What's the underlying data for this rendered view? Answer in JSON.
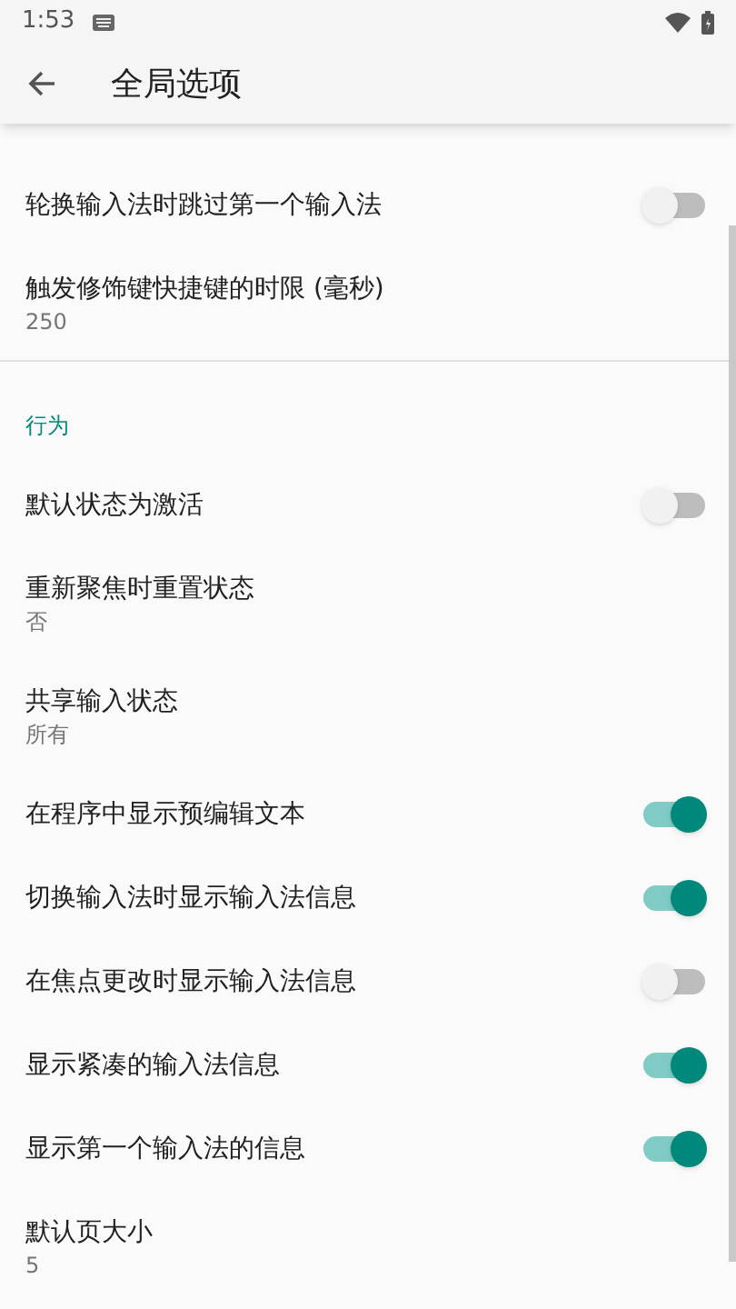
{
  "status_bar": {
    "time": "1:53"
  },
  "app_bar": {
    "title": "全局选项"
  },
  "sections": [
    {
      "items": [
        {
          "kind": "switch",
          "title": "轮换输入法时跳过第一个输入法",
          "on": false
        },
        {
          "kind": "value",
          "title": "触发修饰键快捷键的时限 (毫秒)",
          "summary": "250"
        }
      ]
    },
    {
      "header": "行为",
      "items": [
        {
          "kind": "switch",
          "title": "默认状态为激活",
          "on": false
        },
        {
          "kind": "value",
          "title": "重新聚焦时重置状态",
          "summary": "否"
        },
        {
          "kind": "value",
          "title": "共享输入状态",
          "summary": "所有"
        },
        {
          "kind": "switch",
          "title": "在程序中显示预编辑文本",
          "on": true
        },
        {
          "kind": "switch",
          "title": "切换输入法时显示输入法信息",
          "on": true
        },
        {
          "kind": "switch",
          "title": "在焦点更改时显示输入法信息",
          "on": false
        },
        {
          "kind": "switch",
          "title": "显示紧凑的输入法信息",
          "on": true
        },
        {
          "kind": "switch",
          "title": "显示第一个输入法的信息",
          "on": true
        },
        {
          "kind": "value",
          "title": "默认页大小",
          "summary": "5"
        }
      ]
    }
  ]
}
